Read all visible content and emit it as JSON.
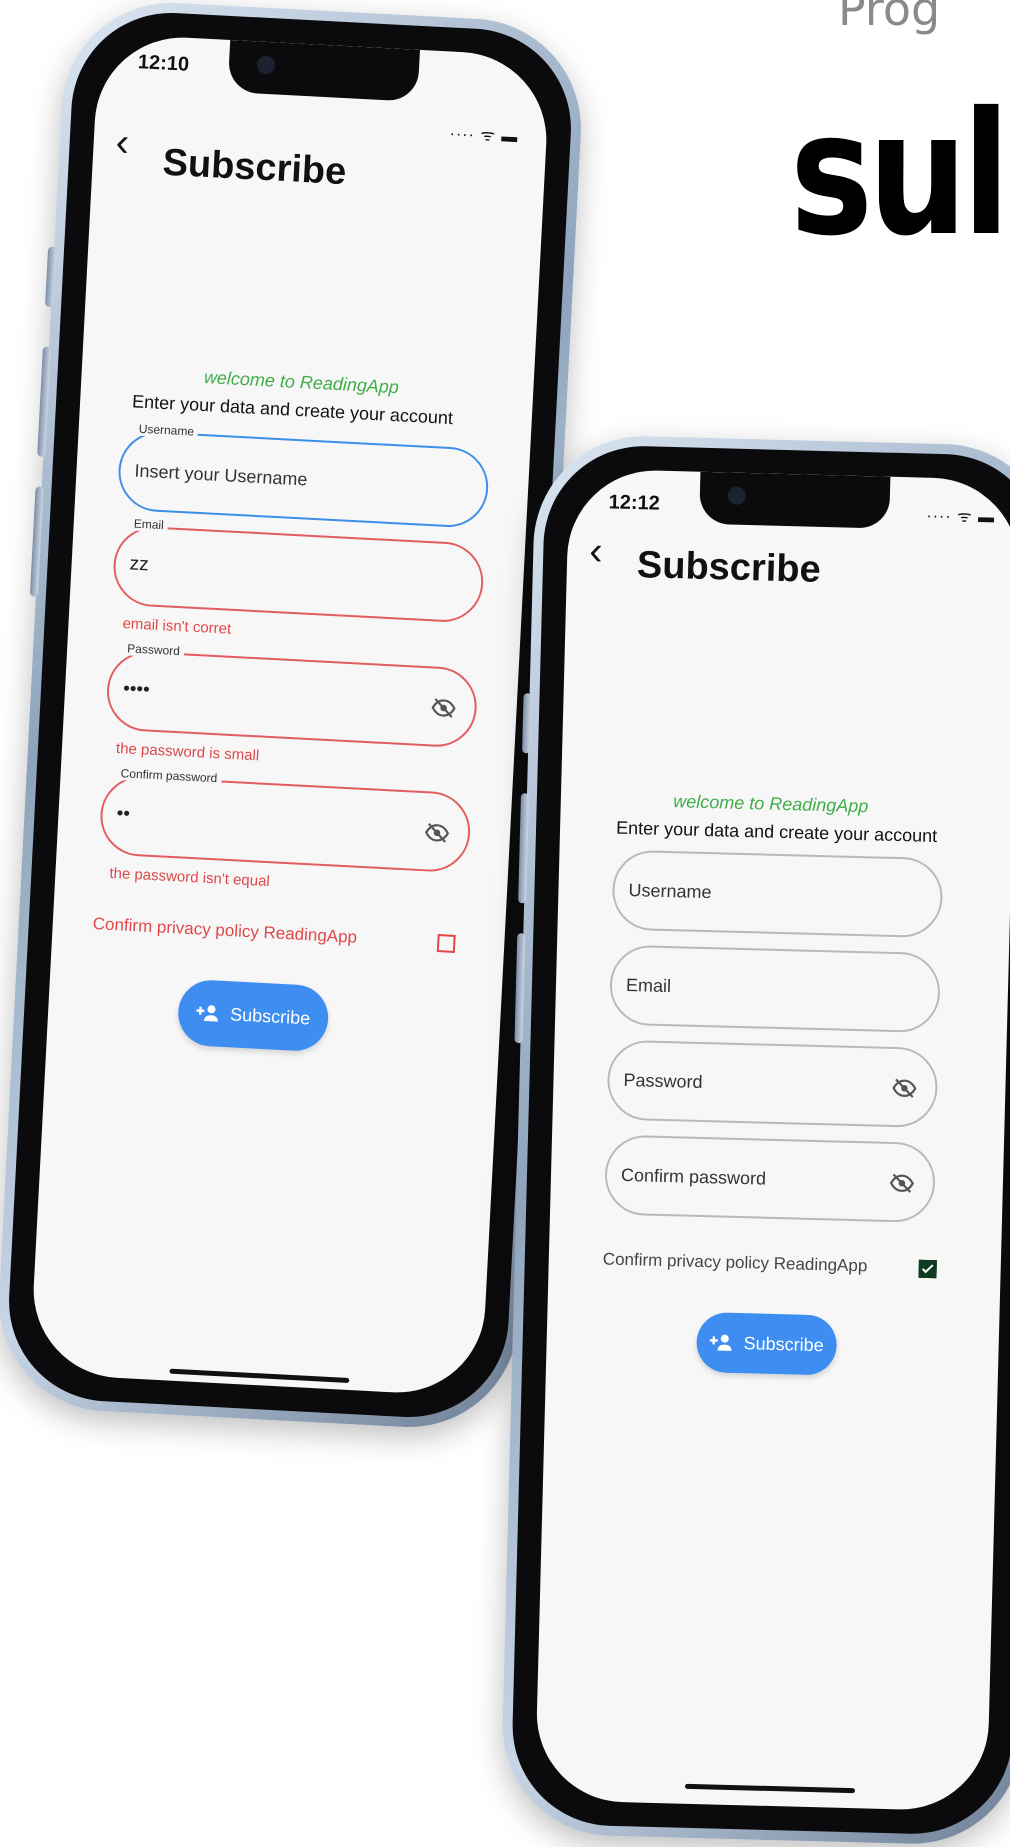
{
  "header": {
    "subtitle": "Prog",
    "title": "sul"
  },
  "phone1": {
    "time": "12:10",
    "signal": "···· ᯤ ▬",
    "back": "‹",
    "title": "Subscribe",
    "welcome": "welcome to ReadingApp",
    "instructions": "Enter your data and create your account",
    "username": {
      "label": "Username",
      "placeholder": "Insert your Username"
    },
    "email": {
      "label": "Email",
      "value": "zz",
      "error": "email isn't corret"
    },
    "password": {
      "label": "Password",
      "value": "••••",
      "error": "the password is small"
    },
    "confirm": {
      "label": "Confirm password",
      "value": "••",
      "error": "the password isn't equal"
    },
    "privacy": "Confirm privacy policy ReadingApp",
    "privacy_checked": false,
    "button": "Subscribe"
  },
  "phone2": {
    "time": "12:12",
    "signal": "···· ᯤ ▬",
    "back": "‹",
    "title": "Subscribe",
    "welcome": "welcome to ReadingApp",
    "instructions": "Enter your data and create your account",
    "username": {
      "placeholder": "Username"
    },
    "email": {
      "placeholder": "Email"
    },
    "password": {
      "placeholder": "Password"
    },
    "confirm": {
      "placeholder": "Confirm password"
    },
    "privacy": "Confirm privacy policy ReadingApp",
    "privacy_checked": true,
    "button": "Subscribe"
  },
  "colors": {
    "accent": "#3d8ef0",
    "error": "#e25d5d",
    "welcome": "#3fae48",
    "focus": "#3d8ee6"
  },
  "icons": {
    "eye": "eye-off-icon",
    "add_person": "person-add-icon",
    "back": "chevron-left-icon"
  }
}
